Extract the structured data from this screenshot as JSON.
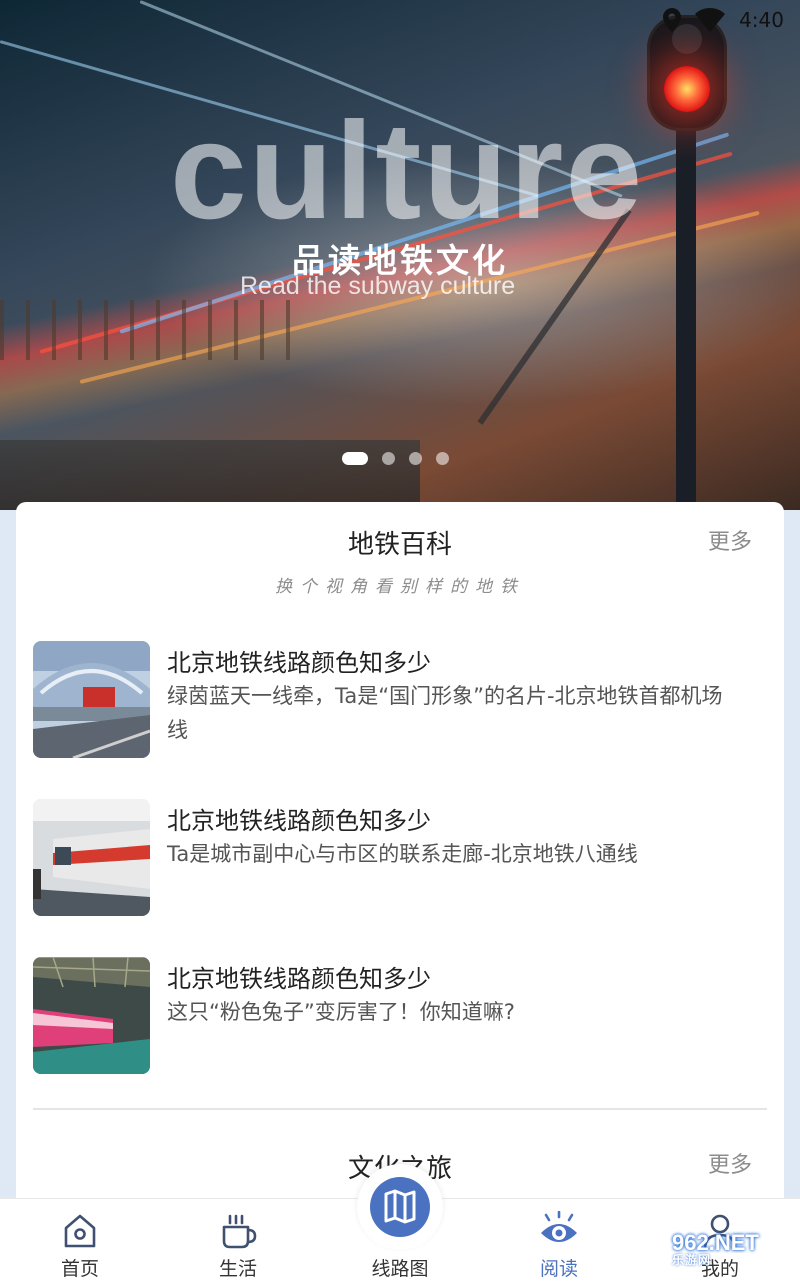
{
  "status_bar": {
    "time": "4:40"
  },
  "banner": {
    "overlay_word": "culture",
    "title": "品读地铁文化",
    "subtitle": "Read the subway culture",
    "carousel_total": 4,
    "carousel_active": 1
  },
  "sections": [
    {
      "title": "地铁百科",
      "more_label": "更多",
      "tagline": "换个视角看别样的地铁",
      "articles": [
        {
          "title": "北京地铁线路颜色知多少",
          "description": "绿茵蓝天一线牵，Ta是“国门形象”的名片-北京地铁首都机场线",
          "thumbnail": "airport-station-image"
        },
        {
          "title": "北京地铁线路颜色知多少",
          "description": "Ta是城市副中心与市区的联系走廊-北京地铁八通线",
          "thumbnail": "red-train-platform-image"
        },
        {
          "title": "北京地铁线路颜色知多少",
          "description": "这只“粉色兔子”变厉害了！你知道嘛?",
          "thumbnail": "pink-train-depot-image"
        }
      ]
    },
    {
      "title": "文化之旅",
      "more_label": "更多"
    }
  ],
  "bottom_nav": {
    "items": [
      {
        "label": "首页",
        "icon": "home-icon"
      },
      {
        "label": "生活",
        "icon": "coffee-cup-icon"
      },
      {
        "label": "线路图",
        "icon": "map-icon"
      },
      {
        "label": "阅读",
        "icon": "eye-icon",
        "active": true
      },
      {
        "label": "我的",
        "icon": "user-icon"
      }
    ]
  },
  "watermark": {
    "main": "962.NET",
    "sub": "乐游网"
  },
  "colors": {
    "accent": "#4a72c0",
    "card_bg": "#ffffff",
    "page_bg": "#dfe9f6"
  }
}
